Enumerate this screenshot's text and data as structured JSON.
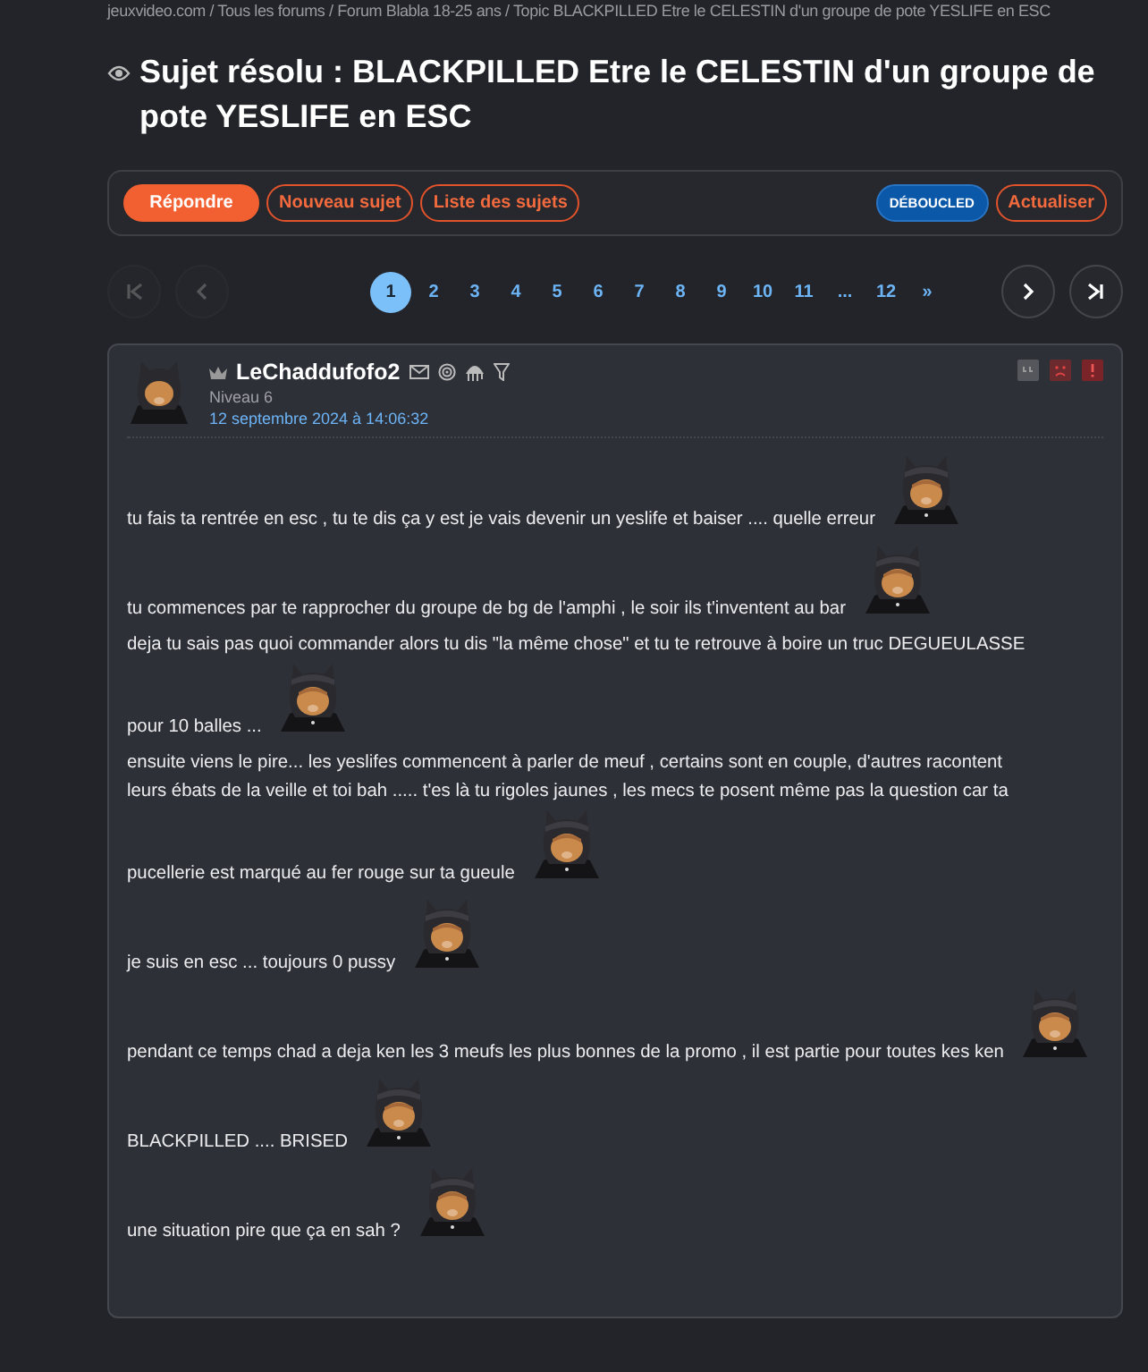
{
  "breadcrumb": "jeuxvideo.com / Tous les forums / Forum Blabla 18-25 ans / Topic BLACKPILLED Etre le CELESTIN d'un groupe de pote YESLIFE en ESC",
  "topic": {
    "title": "Sujet résolu : BLACKPILLED Etre le CELESTIN d'un groupe de pote YESLIFE en ESC"
  },
  "actions": [
    {
      "label": "Répondre",
      "kind": "primary"
    },
    {
      "label": "Nouveau sujet",
      "kind": "outline"
    },
    {
      "label": "Liste des sujets",
      "kind": "outline"
    },
    {
      "label": "DÉBOUCLED",
      "kind": "blue"
    },
    {
      "label": "Actualiser",
      "kind": "outline"
    }
  ],
  "pagination": {
    "nav_left": [
      {
        "kind": "first",
        "disabled": true
      },
      {
        "kind": "prev",
        "disabled": true
      }
    ],
    "pages": [
      {
        "label": "1",
        "selected": true
      },
      {
        "label": "2",
        "selected": false
      },
      {
        "label": "3",
        "selected": false
      },
      {
        "label": "4",
        "selected": false
      },
      {
        "label": "5",
        "selected": false
      },
      {
        "label": "6",
        "selected": false
      },
      {
        "label": "7",
        "selected": false
      },
      {
        "label": "8",
        "selected": false
      },
      {
        "label": "9",
        "selected": false
      },
      {
        "label": "10",
        "selected": false
      },
      {
        "label": "11",
        "selected": false
      },
      {
        "label": "...",
        "selected": false
      },
      {
        "label": "12",
        "selected": false
      },
      {
        "label": "»",
        "selected": false
      }
    ],
    "nav_right": [
      {
        "kind": "next",
        "disabled": false
      },
      {
        "kind": "last",
        "disabled": false
      }
    ]
  },
  "post": {
    "author": "LeChaddufofo2",
    "level": "Niveau 6",
    "date": "12 septembre 2024 à 14:06:32",
    "paragraphs": [
      {
        "lines": [
          "tu fais ta rentrée en esc , tu te dis ça y est je vais devenir un yeslife et baiser .... quelle erreur"
        ],
        "sticker": true
      },
      {
        "lines": [
          "tu commences par te rapprocher du groupe de bg de l'amphi , le soir ils t'inventent au bar"
        ],
        "sticker": true
      },
      {
        "lines": [
          "deja tu sais pas quoi commander alors tu dis \"la même chose\" et tu te retrouve à boire un truc DEGUEULASSE",
          "pour 10 balles ..."
        ],
        "sticker": true
      },
      {
        "lines": [
          "ensuite viens le pire... les yeslifes commencent à parler de meuf , certains sont en couple, d'autres racontent",
          "leurs ébats de la veille et toi bah ..... t'es là tu rigoles jaunes , les mecs te posent même pas la question car ta",
          "pucellerie est marqué au fer rouge sur ta gueule"
        ],
        "sticker": true
      },
      {
        "lines": [
          "je suis en esc ... toujours 0 pussy"
        ],
        "sticker": true
      },
      {
        "lines": [
          "pendant ce temps chad a deja ken les 3 meufs les plus bonnes de la promo , il est partie pour toutes kes ken"
        ],
        "sticker": true
      },
      {
        "lines": [
          "BLACKPILLED .... BRISED"
        ],
        "sticker": true
      },
      {
        "lines": [
          "une situation pire que ça en sah ?"
        ],
        "sticker": true
      }
    ]
  }
}
